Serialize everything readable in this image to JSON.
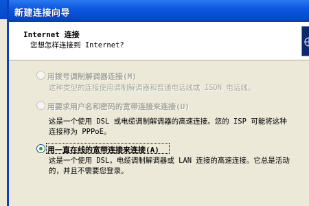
{
  "window": {
    "title": "新建连接向导"
  },
  "header": {
    "title": "Internet 连接",
    "subtitle": "您想怎样连接到 Internet?"
  },
  "options": [
    {
      "label": "用拨号调制解调器连接(M)",
      "desc_lines": [
        "这种类型的连接使用调制解调器和普通电话线或 ISDN 电话线。"
      ],
      "enabled": false,
      "selected": false
    },
    {
      "label": "用要求用户名和密码的宽带连接来连接(U)",
      "desc_lines": [
        "这是一个使用 DSL 或电缆调制解调器的高速连接。您的 ISP 可能将这种",
        "连接称为 PPPoE。"
      ],
      "enabled": true,
      "selected": false
    },
    {
      "label": "用一直在线的宽带连接来连接(A)",
      "desc_lines": [
        "这是一个使用 DSL，电缆调制解调器或 LAN 连接的高速连接。它总是活动",
        "的，并且不需要您登录。"
      ],
      "enabled": true,
      "selected": true
    }
  ],
  "colors": {
    "titlebar": "#0b58df",
    "disabled_text": "#a7a69a",
    "dialog_bg": "#ece9d8"
  }
}
